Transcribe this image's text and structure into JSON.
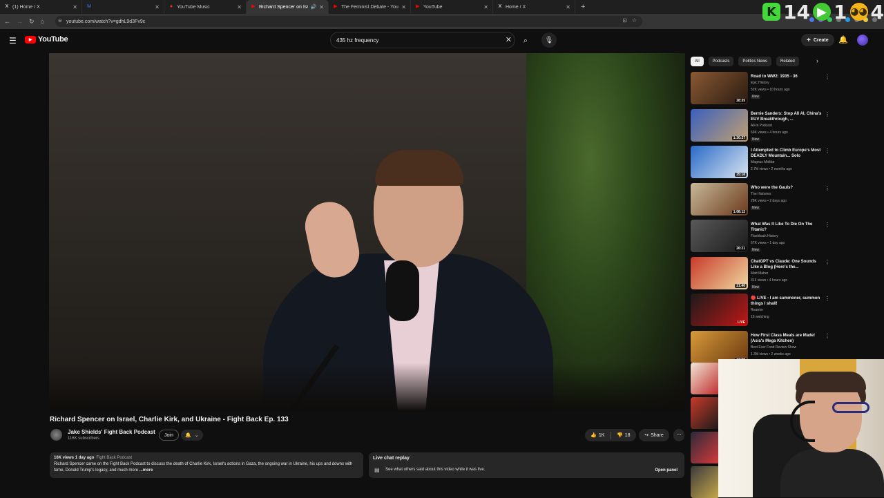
{
  "browser": {
    "tabs": [
      {
        "label": "(1) Home / X",
        "fav": "X",
        "favcolor": "#ffffff",
        "active": false
      },
      {
        "label": "",
        "fav": "M",
        "favcolor": "#4a78e8",
        "active": false
      },
      {
        "label": "YouTube Music",
        "fav": "●",
        "favcolor": "#ff2b2b",
        "active": false
      },
      {
        "label": "Richard Spencer on Israel, ",
        "fav": "▶",
        "favcolor": "#ff0000",
        "active": true
      },
      {
        "label": "The Feminist Debate - YouTube",
        "fav": "▶",
        "favcolor": "#ff0000",
        "active": false
      },
      {
        "label": "YouTube",
        "fav": "▶",
        "favcolor": "#ff0000",
        "active": false
      },
      {
        "label": "Home / X",
        "fav": "X",
        "favcolor": "#ffffff",
        "active": false
      }
    ],
    "url": "youtube.com/watch?v=gdhL9d3Fv9c"
  },
  "overlay": {
    "count1": "14",
    "count2": "1",
    "count3": "4"
  },
  "masthead": {
    "logo_text": "YouTube",
    "search_value": "435 hz frequency",
    "create_label": "Create"
  },
  "video": {
    "title": "Richard Spencer on Israel, Charlie Kirk, and Ukraine - Fight Back Ep. 133",
    "channel": "Jake Shields' Fight Back Podcast",
    "subscribers": "116K subscribers",
    "join_label": "Join",
    "likes": "1K",
    "dislikes": "18",
    "share_label": "Share",
    "description": {
      "meta": "16K views  1 day ago",
      "tag": "Fight Back Podcast",
      "text": "Richard Spencer came on the Fight Back Podcast to discuss the death of Charlie Kirk, Israel's actions in Gaza, the ongoing war in Ukraine, his ups and downs with fame, Donald Trump's legacy, and much more",
      "more": "...more"
    },
    "chat": {
      "title": "Live chat replay",
      "subtitle": "See what others said about this video while it was live.",
      "open_label": "Open panel"
    }
  },
  "chips": [
    "All",
    "Podcasts",
    "Politics News",
    "Related"
  ],
  "recommendations": [
    {
      "title": "Road to WW2: 1935 - 36",
      "channel": "Epic History",
      "stats": "52K views • 10 hours ago",
      "badge": "New",
      "duration": "28:35",
      "c1": "#8a5a34",
      "c2": "#2a1a10",
      "live": false
    },
    {
      "title": "Bernie Sanders: Stop All AI, China's EUV Breakthrough, ...",
      "channel": "All-In Podcast",
      "stats": "69K views • 4 hours ago",
      "badge": "New",
      "duration": "1:30:27",
      "c1": "#3b5fc0",
      "c2": "#c0a070",
      "live": false
    },
    {
      "title": "I Attempted to Climb Europe's Most DEADLY Mountain... Solo",
      "channel": "Magnus Midtbø",
      "stats": "2.7M views • 2 months ago",
      "badge": "",
      "duration": "25:18",
      "c1": "#2a6ac8",
      "c2": "#d8e4f0",
      "live": false
    },
    {
      "title": "Who were the Gauls?",
      "channel": "The Histories",
      "stats": "28K views • 2 days ago",
      "badge": "New",
      "duration": "1:08:12",
      "c1": "#c8b89a",
      "c2": "#6a3a1a",
      "live": false
    },
    {
      "title": "What Was It Like To Die On The Titanic?",
      "channel": "Flashback History",
      "stats": "67K views • 1 day ago",
      "badge": "New",
      "duration": "26:21",
      "c1": "#5a5a5a",
      "c2": "#1a1a1a",
      "live": false
    },
    {
      "title": "ChatGPT vs Claude: One Sounds Like a Blog (Here's the...",
      "channel": "Matt Maher",
      "stats": "313 views • 4 hours ago",
      "badge": "New",
      "duration": "21:40",
      "c1": "#c83a2a",
      "c2": "#f0d8a0",
      "live": false
    },
    {
      "title": "🔴 LIVE - I am summoner, summon things I shall!",
      "channel": "Roarrior",
      "stats": "19 watching",
      "badge": "",
      "duration": "LIVE",
      "c1": "#1a1a1a",
      "c2": "#c01818",
      "live": true
    },
    {
      "title": "How First Class Meals are Made! (Asia's Mega Kitchen)",
      "channel": "Best Ever Food Review Show",
      "stats": "1.3M views • 2 weeks ago",
      "badge": "",
      "duration": "22:09",
      "c1": "#d89a3a",
      "c2": "#6a3a10",
      "live": false
    }
  ],
  "partial_thumbs": [
    {
      "c1": "#f0e8d8",
      "c2": "#c02a2a"
    },
    {
      "c1": "#c83a2a",
      "c2": "#1a1a1a"
    },
    {
      "c1": "#2a2a3a",
      "c2": "#d83a3a"
    },
    {
      "c1": "#3a3a3a",
      "c2": "#c8a84a"
    }
  ]
}
